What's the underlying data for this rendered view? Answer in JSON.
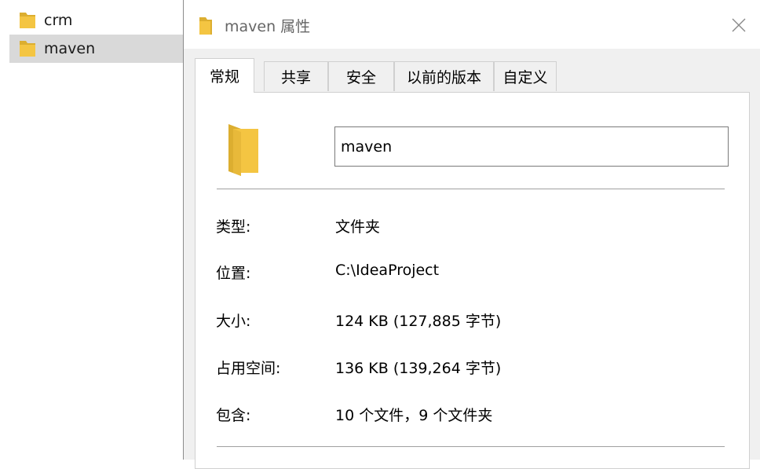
{
  "explorer": {
    "items": [
      {
        "name": "crm",
        "icon": "folder-icon"
      },
      {
        "name": "maven",
        "icon": "folder-icon",
        "selected": true
      }
    ]
  },
  "dialog": {
    "title": "maven 属性",
    "close_glyph": "✕",
    "tabs": [
      {
        "label": "常规",
        "active": true
      },
      {
        "label": "共享"
      },
      {
        "label": "安全"
      },
      {
        "label": "以前的版本"
      },
      {
        "label": "自定义"
      }
    ],
    "general": {
      "folder_name": "maven",
      "properties": [
        {
          "label": "类型:",
          "value": "文件夹"
        },
        {
          "label": "位置:",
          "value": "C:\\IdeaProject"
        },
        {
          "label": "大小:",
          "value": "124 KB (127,885 字节)"
        },
        {
          "label": "占用空间:",
          "value": "136 KB (139,264 字节)"
        },
        {
          "label": "包含:",
          "value": "10 个文件，9 个文件夹"
        }
      ]
    }
  },
  "colors": {
    "folder_yellow": "#f4c542",
    "folder_dark": "#dcae30",
    "selection": "#d9d9d9"
  }
}
